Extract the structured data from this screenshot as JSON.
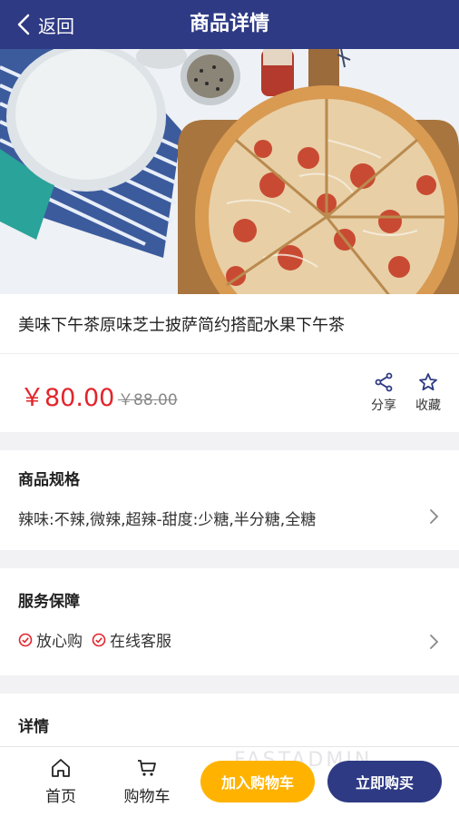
{
  "navbar": {
    "back_label": "返回",
    "title": "商品详情"
  },
  "product": {
    "title": "美味下午茶原味芝士披萨简约搭配水果下午茶",
    "price": "￥80.00",
    "original_price": "￥88.00"
  },
  "actions": {
    "share_label": "分享",
    "favorite_label": "收藏"
  },
  "spec": {
    "title": "商品规格",
    "value": "辣味:不辣,微辣,超辣-甜度:少糖,半分糖,全糖"
  },
  "service": {
    "title": "服务保障",
    "items": [
      "放心购",
      "在线客服"
    ]
  },
  "detail": {
    "title": "详情"
  },
  "bottom_bar": {
    "home_label": "首页",
    "cart_label": "购物车",
    "add_to_cart_label": "加入购物车",
    "buy_now_label": "立即购买",
    "watermark": "FASTADMIN"
  },
  "colors": {
    "primary": "#2e3a84",
    "price_red": "#e3242b",
    "accent_yellow": "#ffb300"
  }
}
